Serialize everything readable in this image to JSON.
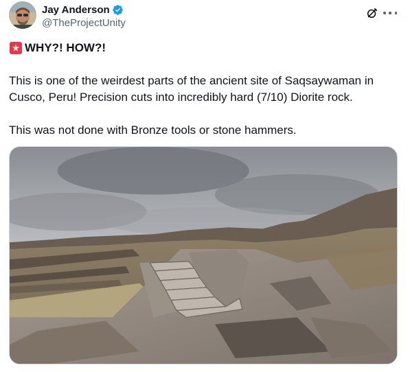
{
  "author": {
    "display_name": "Jay Anderson",
    "handle": "@TheProjectUnity",
    "verified": true
  },
  "icons": {
    "avatar": "avatar-photo",
    "verified": "verified-badge-icon",
    "grok": "grok-icon",
    "more": "more-icon",
    "emoji": "police-car-light-icon"
  },
  "tweet": {
    "headline": "WHY?! HOW?!",
    "paragraph_1": "This is one of the weirdest parts of the ancient site of Saqsaywaman in Cusco, Peru! Precision cuts into incredibly hard (7/10) Diorite rock.",
    "paragraph_2": "This was not done with Bronze tools or stone hammers."
  },
  "colors": {
    "verified_blue": "#1d9bf0",
    "siren_red": "#e8364a",
    "secondary_text": "#536471"
  }
}
